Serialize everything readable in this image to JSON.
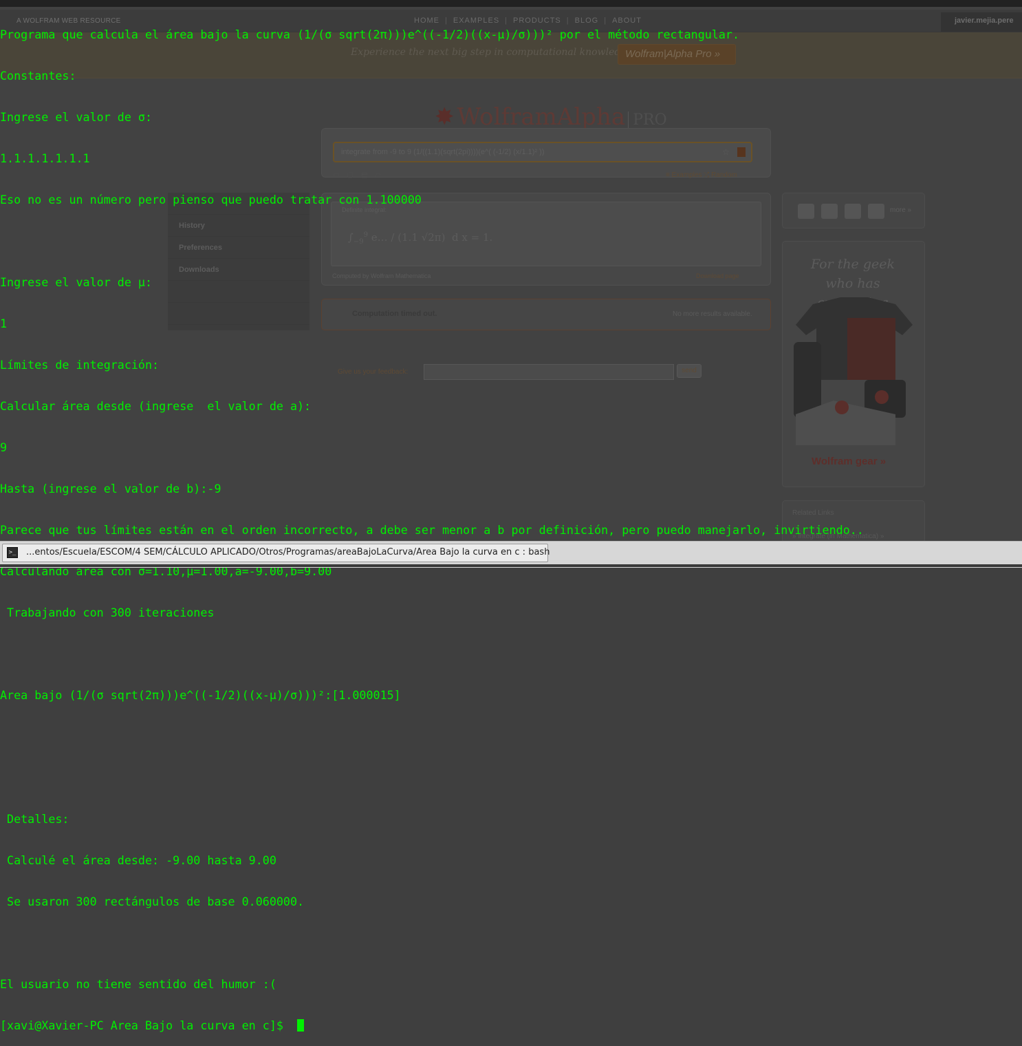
{
  "web": {
    "brand": "A WOLFRAM WEB RESOURCE",
    "nav": [
      "HOME",
      "EXAMPLES",
      "PRODUCTS",
      "BLOG",
      "ABOUT"
    ],
    "user": "javier.mejia.pere",
    "promo_text": "Experience the next big step in computational knowledge:",
    "promo_button": "Wolfram|Alpha Pro »",
    "logo": "WolframAlpha",
    "logo_pro": "PRO",
    "search_value": "integrate from -9 to 9 (1/((1.1)(sqrt(2pi))))(e^(  (-1/2) (x/1.1)²       ))",
    "examples_link": "≡ Examples   ⤮ Random",
    "sidebar": [
      "History",
      "Preferences",
      "Downloads"
    ],
    "pod_title": "Definite integral:",
    "formula_result": "d x = 1.",
    "computed_by": "Computed by Wolfram Mathematica",
    "download_page": "Download page",
    "timeout": "Computation timed out.",
    "no_more": "No more results available.",
    "feedback_label": "Give us your feedback:",
    "feedback_send": "send",
    "share_more": "more »",
    "gear_title": "For the geek who has everything",
    "gear_link": "Wolfram gear »",
    "related_title": "Related Links",
    "related_item": "» Integrate (in Mathematica) »"
  },
  "terminal": {
    "lines": [
      "Programa que calcula el área bajo la curva (1/(σ sqrt(2π)))e^((-1/2)((x-μ)/σ)))² por el método rectangular.",
      "Constantes:",
      "Ingrese el valor de σ:",
      "1.1.1.1.1.1.1",
      "Eso no es un número pero pienso que puedo tratar con 1.100000",
      "",
      "Ingrese el valor de μ:",
      "1",
      "Límites de integración:",
      "Calcular área desde (ingrese  el valor de a):",
      "9",
      "Hasta (ingrese el valor de b):-9",
      "Parece que tus límites están en el orden incorrecto, a debe ser menor a b por definición, pero puedo manejarlo, invirtiendo..",
      "Calculando área con σ=1.10,μ=1.00,a=-9.00,b=9.00",
      " Trabajando con 300 iteraciones",
      "",
      "Area bajo (1/(σ sqrt(2π)))e^((-1/2)((x-μ)/σ)))²:[1.000015]",
      "",
      "",
      " Detalles:",
      " Calculé el área desde: -9.00 hasta 9.00",
      " Se usaron 300 rectángulos de base 0.060000.",
      "",
      "El usuario no tiene sentido del humor :("
    ],
    "prompt": "[xavi@Xavier-PC Area Bajo la curva en c]$ "
  },
  "taskbar": {
    "icon": "terminal-icon",
    "label": "...entos/Escuela/ESCOM/4 SEM/CÁLCULO APLICADO/Otros/Programas/areaBajoLaCurva/Area Bajo la curva en c : bash"
  },
  "colors": {
    "terminal_text": "#00f000",
    "background": "#424242"
  }
}
